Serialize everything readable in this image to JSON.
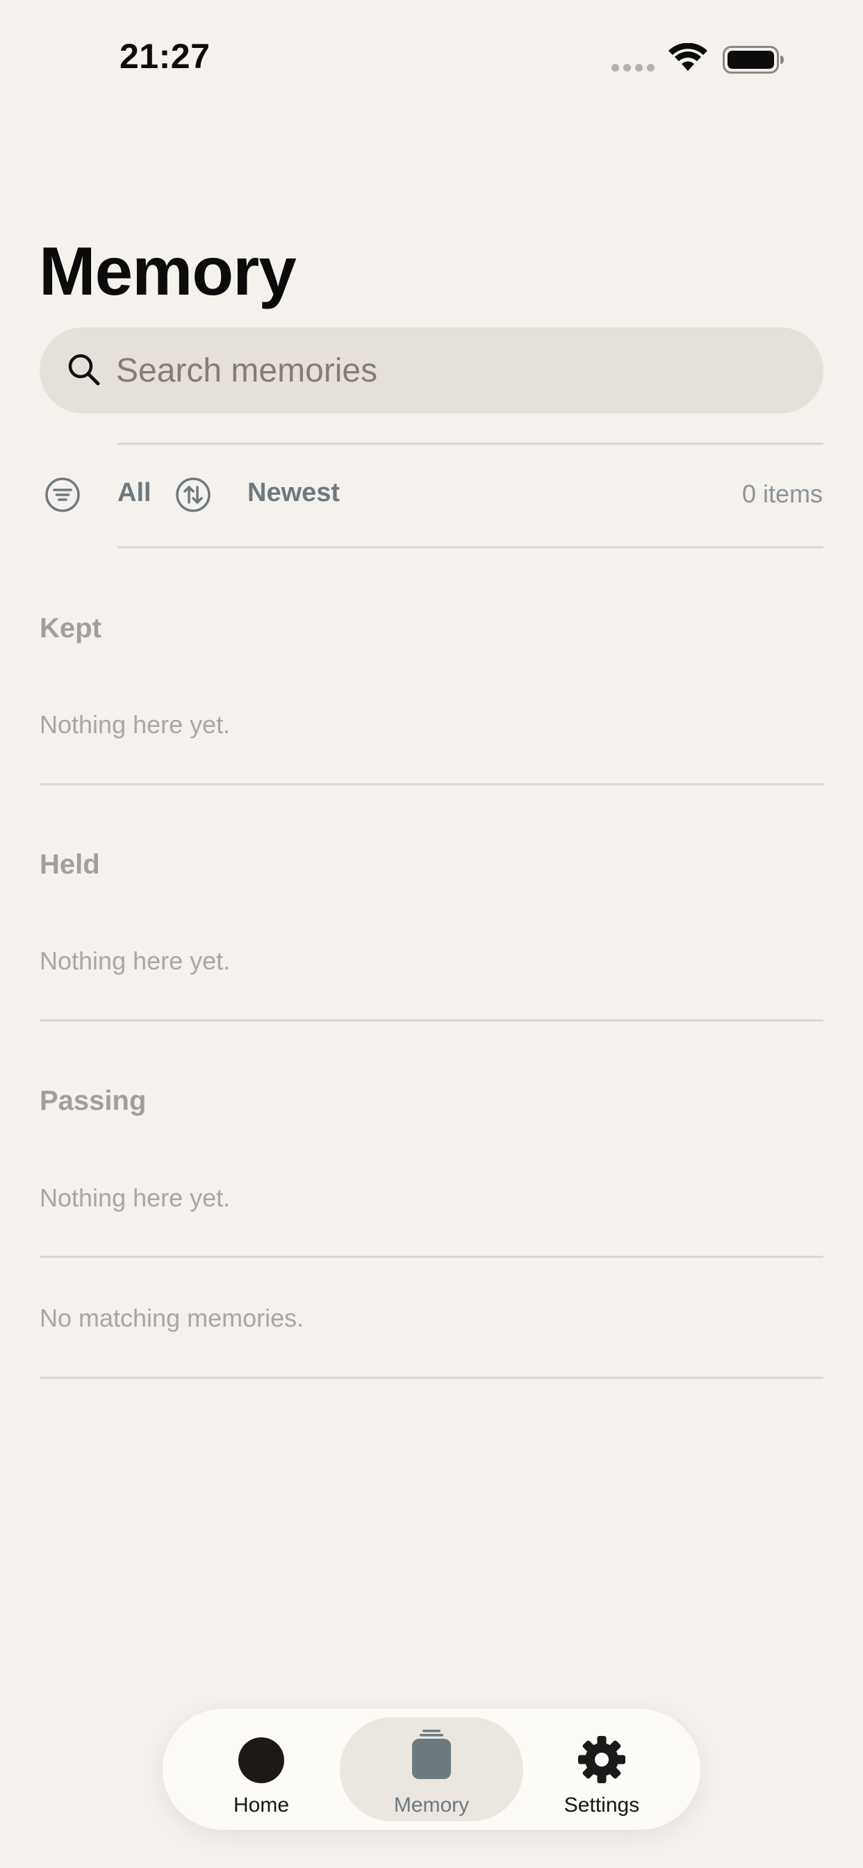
{
  "status_bar": {
    "time": "21:27"
  },
  "header": {
    "title": "Memory"
  },
  "search": {
    "placeholder": "Search memories"
  },
  "filters": {
    "filter_label": "All",
    "sort_label": "Newest",
    "count_label": "0 items"
  },
  "sections": [
    {
      "title": "Kept",
      "empty_text": "Nothing here yet."
    },
    {
      "title": "Held",
      "empty_text": "Nothing here yet."
    },
    {
      "title": "Passing",
      "empty_text": "Nothing here yet."
    }
  ],
  "empty_state": "No matching memories.",
  "tabs": [
    {
      "label": "Home",
      "icon": "circle-icon",
      "active": false
    },
    {
      "label": "Memory",
      "icon": "jar-icon",
      "active": true
    },
    {
      "label": "Settings",
      "icon": "gear-icon",
      "active": false
    }
  ],
  "colors": {
    "background": "#f5f1ed",
    "accent": "#6d7a80",
    "search_bg": "#e6e0db"
  }
}
